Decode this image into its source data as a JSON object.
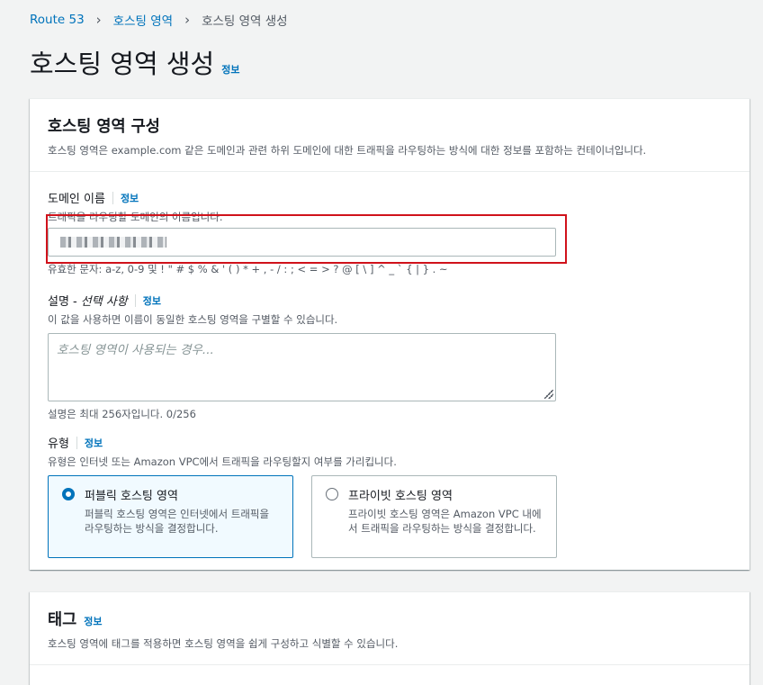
{
  "breadcrumb": {
    "root": "Route 53",
    "parent": "호스팅 영역",
    "current": "호스팅 영역 생성",
    "separator": "›"
  },
  "page": {
    "title": "호스팅 영역 생성",
    "info": "정보"
  },
  "config": {
    "title": "호스팅 영역 구성",
    "description": "호스팅 영역은 example.com 같은 도메인과 관련 하위 도메인에 대한 트래픽을 라우팅하는 방식에 대한 정보를 포함하는 컨테이너입니다.",
    "domain": {
      "label": "도메인 이름",
      "info": "정보",
      "description": "트래픽을 라우팅할 도메인의 이름입니다.",
      "constraint": "유효한 문자: a-z, 0-9 및 ! \" # $ % & ' ( ) * + , - / : ; < = > ? @ [ \\ ] ^ _ ` { | } . ~"
    },
    "comment": {
      "label": "설명 -",
      "optional": "선택 사항",
      "info": "정보",
      "description": "이 값을 사용하면 이름이 동일한 호스팅 영역을 구별할 수 있습니다.",
      "placeholder": "호스팅 영역이 사용되는 경우...",
      "counter": "설명은 최대 256자입니다. 0/256"
    },
    "type": {
      "label": "유형",
      "info": "정보",
      "description": "유형은 인터넷 또는 Amazon VPC에서 트래픽을 라우팅할지 여부를 가리킵니다.",
      "options": [
        {
          "title": "퍼블릭 호스팅 영역",
          "description": "퍼블릭 호스팅 영역은 인터넷에서 트래픽을 라우팅하는 방식을 결정합니다.",
          "selected": true
        },
        {
          "title": "프라이빗 호스팅 영역",
          "description": "프라이빗 호스팅 영역은 Amazon VPC 내에서 트래픽을 라우팅하는 방식을 결정합니다.",
          "selected": false
        }
      ]
    }
  },
  "tags": {
    "title": "태그",
    "info": "정보",
    "description": "호스팅 영역에 태그를 적용하면 호스팅 영역을 쉽게 구성하고 식별할 수 있습니다."
  },
  "colors": {
    "accent": "#0073bb",
    "highlight": "#d0121b"
  }
}
